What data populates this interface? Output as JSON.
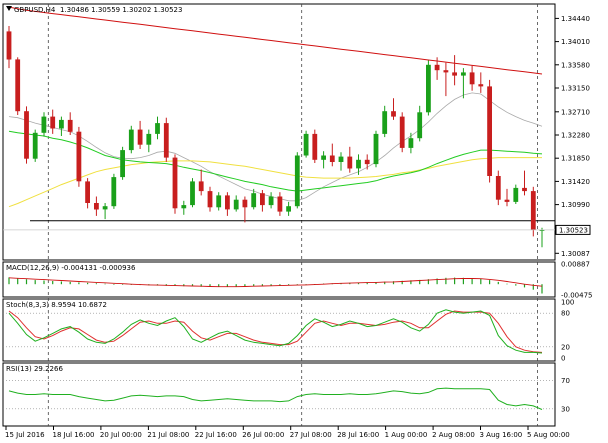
{
  "chart_data": {
    "type": "candlestick",
    "symbol_label": "GBPUSD,H4",
    "ohlc_header": "1.30486 1.30559 1.30202 1.30523",
    "current_price": "1.30523",
    "colors": {
      "bull": "#1aa01a",
      "bear": "#c81e1e",
      "ma_fast": "#22cc22",
      "ma_mid": "#f0e040",
      "ma_slow": "#d01010",
      "ma_gray": "#a9a9a9",
      "support_line": "#000000",
      "stoch_main": "#20b020",
      "stoch_signal": "#e03030",
      "rsi": "#20b020",
      "macd_hist": "#20a020"
    },
    "price_axis": {
      "ticks": [
        "1.34440",
        "1.34010",
        "1.33580",
        "1.33150",
        "1.32710",
        "1.32280",
        "1.31850",
        "1.31420",
        "1.30990",
        "1.30523",
        "1.30087"
      ],
      "ylim": [
        1.3,
        1.3467
      ]
    },
    "support_level": 1.3069,
    "candles": [
      {
        "o": 1.342,
        "h": 1.343,
        "l": 1.3352,
        "c": 1.3368
      },
      {
        "o": 1.3368,
        "h": 1.3372,
        "l": 1.3265,
        "c": 1.3272
      },
      {
        "o": 1.3272,
        "h": 1.3281,
        "l": 1.3175,
        "c": 1.3184
      },
      {
        "o": 1.3184,
        "h": 1.3238,
        "l": 1.3178,
        "c": 1.3232
      },
      {
        "o": 1.3232,
        "h": 1.327,
        "l": 1.3225,
        "c": 1.3262
      },
      {
        "o": 1.3262,
        "h": 1.3275,
        "l": 1.323,
        "c": 1.324
      },
      {
        "o": 1.324,
        "h": 1.3262,
        "l": 1.3226,
        "c": 1.3256
      },
      {
        "o": 1.3256,
        "h": 1.327,
        "l": 1.3228,
        "c": 1.3234
      },
      {
        "o": 1.3234,
        "h": 1.3243,
        "l": 1.3132,
        "c": 1.3142
      },
      {
        "o": 1.3142,
        "h": 1.3148,
        "l": 1.3092,
        "c": 1.3102
      },
      {
        "o": 1.3102,
        "h": 1.3114,
        "l": 1.3078,
        "c": 1.309
      },
      {
        "o": 1.309,
        "h": 1.3102,
        "l": 1.3072,
        "c": 1.3096
      },
      {
        "o": 1.3096,
        "h": 1.3156,
        "l": 1.3091,
        "c": 1.315
      },
      {
        "o": 1.315,
        "h": 1.3206,
        "l": 1.3145,
        "c": 1.32
      },
      {
        "o": 1.32,
        "h": 1.3245,
        "l": 1.3194,
        "c": 1.3238
      },
      {
        "o": 1.3238,
        "h": 1.3254,
        "l": 1.3202,
        "c": 1.321
      },
      {
        "o": 1.321,
        "h": 1.3238,
        "l": 1.3196,
        "c": 1.323
      },
      {
        "o": 1.323,
        "h": 1.3262,
        "l": 1.322,
        "c": 1.325
      },
      {
        "o": 1.325,
        "h": 1.326,
        "l": 1.3178,
        "c": 1.3186
      },
      {
        "o": 1.3186,
        "h": 1.3192,
        "l": 1.3082,
        "c": 1.3092
      },
      {
        "o": 1.3092,
        "h": 1.3106,
        "l": 1.308,
        "c": 1.3098
      },
      {
        "o": 1.3098,
        "h": 1.3148,
        "l": 1.3094,
        "c": 1.3142
      },
      {
        "o": 1.3142,
        "h": 1.3164,
        "l": 1.3116,
        "c": 1.3124
      },
      {
        "o": 1.3124,
        "h": 1.3132,
        "l": 1.3086,
        "c": 1.3094
      },
      {
        "o": 1.3094,
        "h": 1.3122,
        "l": 1.3088,
        "c": 1.3116
      },
      {
        "o": 1.3116,
        "h": 1.3122,
        "l": 1.3078,
        "c": 1.309
      },
      {
        "o": 1.309,
        "h": 1.3116,
        "l": 1.3086,
        "c": 1.3108
      },
      {
        "o": 1.3108,
        "h": 1.3114,
        "l": 1.3066,
        "c": 1.3094
      },
      {
        "o": 1.3094,
        "h": 1.3128,
        "l": 1.309,
        "c": 1.312
      },
      {
        "o": 1.312,
        "h": 1.3126,
        "l": 1.3086,
        "c": 1.3098
      },
      {
        "o": 1.3098,
        "h": 1.3122,
        "l": 1.3092,
        "c": 1.3114
      },
      {
        "o": 1.3114,
        "h": 1.3122,
        "l": 1.3078,
        "c": 1.3086
      },
      {
        "o": 1.3086,
        "h": 1.3104,
        "l": 1.3078,
        "c": 1.3096
      },
      {
        "o": 1.3096,
        "h": 1.3196,
        "l": 1.3092,
        "c": 1.319
      },
      {
        "o": 1.319,
        "h": 1.3236,
        "l": 1.3186,
        "c": 1.323
      },
      {
        "o": 1.323,
        "h": 1.3238,
        "l": 1.3176,
        "c": 1.3182
      },
      {
        "o": 1.3182,
        "h": 1.3198,
        "l": 1.3166,
        "c": 1.319
      },
      {
        "o": 1.319,
        "h": 1.3212,
        "l": 1.317,
        "c": 1.3178
      },
      {
        "o": 1.3178,
        "h": 1.3196,
        "l": 1.3162,
        "c": 1.3188
      },
      {
        "o": 1.3188,
        "h": 1.3206,
        "l": 1.3158,
        "c": 1.3166
      },
      {
        "o": 1.3166,
        "h": 1.3192,
        "l": 1.3154,
        "c": 1.3182
      },
      {
        "o": 1.3182,
        "h": 1.3192,
        "l": 1.3164,
        "c": 1.3174
      },
      {
        "o": 1.3174,
        "h": 1.3236,
        "l": 1.3168,
        "c": 1.323
      },
      {
        "o": 1.323,
        "h": 1.3282,
        "l": 1.3224,
        "c": 1.3272
      },
      {
        "o": 1.3272,
        "h": 1.3296,
        "l": 1.3256,
        "c": 1.3262
      },
      {
        "o": 1.3262,
        "h": 1.327,
        "l": 1.3196,
        "c": 1.3204
      },
      {
        "o": 1.3204,
        "h": 1.3232,
        "l": 1.3194,
        "c": 1.3222
      },
      {
        "o": 1.3222,
        "h": 1.3282,
        "l": 1.3216,
        "c": 1.327
      },
      {
        "o": 1.327,
        "h": 1.3366,
        "l": 1.3264,
        "c": 1.3358
      },
      {
        "o": 1.3358,
        "h": 1.3372,
        "l": 1.333,
        "c": 1.3348
      },
      {
        "o": 1.3348,
        "h": 1.3362,
        "l": 1.33,
        "c": 1.3344
      },
      {
        "o": 1.3344,
        "h": 1.3376,
        "l": 1.332,
        "c": 1.3338
      },
      {
        "o": 1.3338,
        "h": 1.3352,
        "l": 1.3296,
        "c": 1.3344
      },
      {
        "o": 1.3344,
        "h": 1.3356,
        "l": 1.331,
        "c": 1.3322
      },
      {
        "o": 1.3322,
        "h": 1.3344,
        "l": 1.3306,
        "c": 1.3318
      },
      {
        "o": 1.3318,
        "h": 1.333,
        "l": 1.314,
        "c": 1.3152
      },
      {
        "o": 1.3152,
        "h": 1.3162,
        "l": 1.3098,
        "c": 1.3108
      },
      {
        "o": 1.3108,
        "h": 1.3128,
        "l": 1.3096,
        "c": 1.3104
      },
      {
        "o": 1.3104,
        "h": 1.3136,
        "l": 1.31,
        "c": 1.313
      },
      {
        "o": 1.313,
        "h": 1.3162,
        "l": 1.3116,
        "c": 1.3124
      },
      {
        "o": 1.3124,
        "h": 1.3132,
        "l": 1.304,
        "c": 1.3052
      },
      {
        "o": 1.3052,
        "h": 1.3056,
        "l": 1.302,
        "c": 1.3052
      }
    ],
    "ma_fast": [
      1.3235,
      1.3232,
      1.323,
      1.3228,
      1.3226,
      1.3222,
      1.3219,
      1.3215,
      1.321,
      1.3204,
      1.3197,
      1.319,
      1.3186,
      1.3182,
      1.318,
      1.3178,
      1.3177,
      1.3176,
      1.3175,
      1.3172,
      1.3168,
      1.3165,
      1.3162,
      1.3158,
      1.3154,
      1.315,
      1.3146,
      1.3142,
      1.3139,
      1.3136,
      1.3132,
      1.3129,
      1.3126,
      1.3124,
      1.3126,
      1.3128,
      1.313,
      1.3132,
      1.3134,
      1.3136,
      1.3138,
      1.314,
      1.3143,
      1.3148,
      1.3152,
      1.3155,
      1.3158,
      1.3162,
      1.3168,
      1.3175,
      1.3181,
      1.3187,
      1.3192,
      1.3196,
      1.32,
      1.32,
      1.3199,
      1.3198,
      1.3197,
      1.3196,
      1.3194,
      1.3193
    ],
    "ma_mid": [
      1.3095,
      1.3101,
      1.3108,
      1.3115,
      1.3122,
      1.3129,
      1.3136,
      1.3142,
      1.3148,
      1.3154,
      1.316,
      1.3164,
      1.3167,
      1.317,
      1.3173,
      1.3175,
      1.3177,
      1.3178,
      1.3179,
      1.318,
      1.318,
      1.318,
      1.3179,
      1.3178,
      1.3176,
      1.3174,
      1.3172,
      1.317,
      1.3167,
      1.3164,
      1.3161,
      1.3158,
      1.3155,
      1.3152,
      1.315,
      1.3149,
      1.3148,
      1.3148,
      1.3148,
      1.3148,
      1.3149,
      1.315,
      1.3151,
      1.3153,
      1.3155,
      1.3158,
      1.316,
      1.3163,
      1.3166,
      1.317,
      1.3173,
      1.3176,
      1.3179,
      1.3182,
      1.3184,
      1.3185,
      1.3186,
      1.3186,
      1.3186,
      1.3186,
      1.3186,
      1.3186
    ],
    "ma_slow": [
      1.3465,
      1.3462,
      1.3459,
      1.3457,
      1.3455,
      1.3453,
      1.3451,
      1.3449,
      1.3447,
      1.3445,
      1.3443,
      1.3441,
      1.3439,
      1.3437,
      1.3435,
      1.3433,
      1.3431,
      1.3429,
      1.3427,
      1.3425,
      1.3423,
      1.3421,
      1.3419,
      1.3417,
      1.3415,
      1.3413,
      1.3411,
      1.3409,
      1.3407,
      1.3405,
      1.3403,
      1.3401,
      1.3399,
      1.3397,
      1.3395,
      1.3393,
      1.3391,
      1.3389,
      1.3387,
      1.3385,
      1.3383,
      1.3381,
      1.3379,
      1.3377,
      1.3375,
      1.3373,
      1.3371,
      1.3369,
      1.3367,
      1.3365,
      1.3363,
      1.3361,
      1.3359,
      1.3357,
      1.3355,
      1.3353,
      1.3351,
      1.3349,
      1.3347,
      1.3345,
      1.3343,
      1.3341
    ],
    "ma_gray": [
      1.3262,
      1.326,
      1.3255,
      1.325,
      1.3246,
      1.3242,
      1.3238,
      1.3234,
      1.3226,
      1.3216,
      1.3205,
      1.3195,
      1.3188,
      1.3185,
      1.3184,
      1.3186,
      1.319,
      1.3196,
      1.3198,
      1.3194,
      1.3186,
      1.3178,
      1.317,
      1.316,
      1.3152,
      1.3144,
      1.3136,
      1.3128,
      1.3124,
      1.3118,
      1.3114,
      1.311,
      1.3106,
      1.3106,
      1.3112,
      1.3122,
      1.3132,
      1.314,
      1.3148,
      1.3154,
      1.316,
      1.3168,
      1.3178,
      1.319,
      1.3204,
      1.3216,
      1.3226,
      1.3238,
      1.3252,
      1.3268,
      1.3282,
      1.3294,
      1.3302,
      1.3306,
      1.3304,
      1.3292,
      1.328,
      1.327,
      1.3262,
      1.3255,
      1.325,
      1.3244
    ],
    "macd": {
      "label": "MACD(12,26,9) -0.004131 -0.000936",
      "ticks": [
        "0.00887",
        "-0.00475"
      ],
      "histogram": [
        0.003,
        0.0026,
        0.0022,
        0.0018,
        0.0016,
        0.0014,
        0.0012,
        0.001,
        0.0008,
        0.0006,
        0.0004,
        0.0002,
        0.0,
        -0.0002,
        -0.0003,
        -0.0004,
        -0.0005,
        -0.0006,
        -0.0007,
        -0.0008,
        -0.0009,
        -0.001,
        -0.0011,
        -0.0012,
        -0.0012,
        -0.0012,
        -0.0011,
        -0.001,
        -0.0009,
        -0.0008,
        -0.0007,
        -0.0006,
        -0.0005,
        -0.0003,
        -0.0001,
        0.0001,
        0.0003,
        0.0004,
        0.0005,
        0.0006,
        0.0007,
        0.0008,
        0.0009,
        0.0011,
        0.0013,
        0.0015,
        0.0017,
        0.0019,
        0.0022,
        0.0025,
        0.0028,
        0.0029,
        0.0028,
        0.0026,
        0.0023,
        0.0018,
        0.001,
        0.0002,
        -0.0006,
        -0.0014,
        -0.0024,
        -0.0041
      ],
      "signal": [
        0.0028,
        0.0026,
        0.0024,
        0.0022,
        0.002,
        0.0018,
        0.0016,
        0.0014,
        0.0012,
        0.001,
        0.0008,
        0.0006,
        0.0004,
        0.0002,
        0.0,
        -0.0002,
        -0.0003,
        -0.0004,
        -0.0005,
        -0.0006,
        -0.0007,
        -0.0008,
        -0.0009,
        -0.001,
        -0.0011,
        -0.0011,
        -0.0011,
        -0.001,
        -0.0009,
        -0.0008,
        -0.0007,
        -0.0006,
        -0.0005,
        -0.0004,
        -0.0003,
        -0.0002,
        0.0,
        0.0002,
        0.0004,
        0.0005,
        0.0006,
        0.0007,
        0.0008,
        0.0009,
        0.001,
        0.0012,
        0.0014,
        0.0016,
        0.0018,
        0.002,
        0.0022,
        0.0024,
        0.0025,
        0.0025,
        0.0024,
        0.0021,
        0.0017,
        0.0012,
        0.0006,
        0.0,
        -0.0005,
        -0.0009
      ]
    },
    "stochastic": {
      "label": "Stoch(8,3,3) 8.9594 10.6872",
      "ticks": [
        "100",
        "80",
        "20",
        "0"
      ],
      "main": [
        80,
        62,
        42,
        30,
        36,
        44,
        52,
        56,
        46,
        34,
        28,
        26,
        34,
        46,
        60,
        68,
        62,
        58,
        66,
        72,
        56,
        34,
        28,
        36,
        44,
        48,
        40,
        32,
        28,
        26,
        24,
        22,
        26,
        40,
        58,
        70,
        64,
        56,
        60,
        66,
        62,
        56,
        58,
        64,
        70,
        64,
        54,
        48,
        60,
        80,
        86,
        82,
        80,
        82,
        84,
        76,
        40,
        22,
        14,
        10,
        10,
        9
      ],
      "signal": [
        84,
        72,
        54,
        38,
        34,
        40,
        48,
        54,
        52,
        42,
        32,
        28,
        30,
        40,
        52,
        64,
        66,
        62,
        62,
        66,
        64,
        48,
        36,
        32,
        38,
        44,
        44,
        38,
        32,
        28,
        26,
        24,
        24,
        30,
        46,
        62,
        66,
        62,
        58,
        62,
        62,
        60,
        58,
        60,
        64,
        66,
        62,
        54,
        54,
        66,
        78,
        84,
        82,
        82,
        82,
        80,
        62,
        38,
        20,
        14,
        11,
        10
      ]
    },
    "rsi": {
      "label": "RSI(13) 29.2266",
      "ticks": [
        "70",
        "30"
      ],
      "values": [
        55,
        52,
        50,
        50,
        51,
        50,
        50,
        50,
        47,
        45,
        43,
        41,
        42,
        45,
        48,
        49,
        48,
        47,
        48,
        48,
        47,
        43,
        41,
        42,
        43,
        44,
        43,
        42,
        41,
        41,
        41,
        40,
        41,
        47,
        50,
        51,
        50,
        50,
        50,
        51,
        50,
        50,
        51,
        53,
        55,
        54,
        52,
        51,
        53,
        58,
        59,
        58,
        58,
        58,
        58,
        57,
        42,
        36,
        34,
        36,
        34,
        29
      ]
    },
    "x_axis": [
      "15 Jul 2016",
      "18 Jul 16:00",
      "20 Jul 00:00",
      "21 Jul 08:00",
      "22 Jul 16:00",
      "26 Jul 00:00",
      "27 Jul 08:00",
      "28 Jul 16:00",
      "1 Aug 00:00",
      "2 Aug 08:00",
      "3 Aug 16:00",
      "5 Aug 00:00"
    ]
  }
}
